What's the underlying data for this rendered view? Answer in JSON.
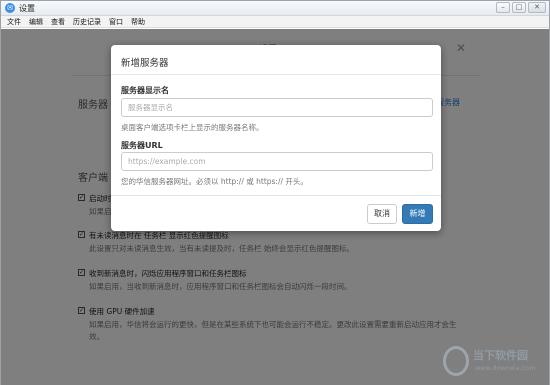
{
  "window": {
    "title": "设置",
    "controls": {
      "minimize": "–",
      "maximize": "□",
      "close": "✕"
    }
  },
  "menu": [
    "文件",
    "编辑",
    "查看",
    "历史记录",
    "窗口",
    "帮助"
  ],
  "settings": {
    "title": "设置",
    "server_label": "服务器",
    "add_server_link": "增服务器",
    "client_section": "客户端",
    "options": [
      {
        "label": "启动时",
        "desc": "如果启",
        "checked": true
      },
      {
        "label": "有未读消息时在 任务栏 显示红色提醒图标",
        "desc": "此设置只对未读消息生效，当有未读提及时，任务栏 始终会显示红色提醒图标。",
        "checked": true
      },
      {
        "label": "收到新消息时，闪烁应用程序窗口和任务栏图标",
        "desc": "如果启用，当收到新消息时，应用程序窗口和任务栏图标会自动闪烁一段时间。",
        "checked": true
      },
      {
        "label": "使用 GPU 硬件加速",
        "desc": "如果启用，华信将会运行的更快，但是在某些系统下也可能会运行不稳定。更改此设置需要重新启动应用才会生",
        "desc2": "效。",
        "checked": true
      }
    ]
  },
  "modal": {
    "title": "新增服务器",
    "name_label": "服务器显示名",
    "name_placeholder": "服务器显示名",
    "name_help": "桌面客户端选项卡栏上显示的服务器名称。",
    "url_label": "服务器URL",
    "url_placeholder": "https://example.com",
    "url_help": "您的华信服务器网址。必须以 http:// 或 https:// 开头。",
    "cancel_label": "取消",
    "add_label": "新增"
  },
  "watermark": {
    "text": "当下软件园",
    "url": "www.downxia.com"
  },
  "colors": {
    "primary": "#337ab7",
    "link": "#2a7fd6",
    "overlay": "rgba(0,0,0,0.5)"
  }
}
